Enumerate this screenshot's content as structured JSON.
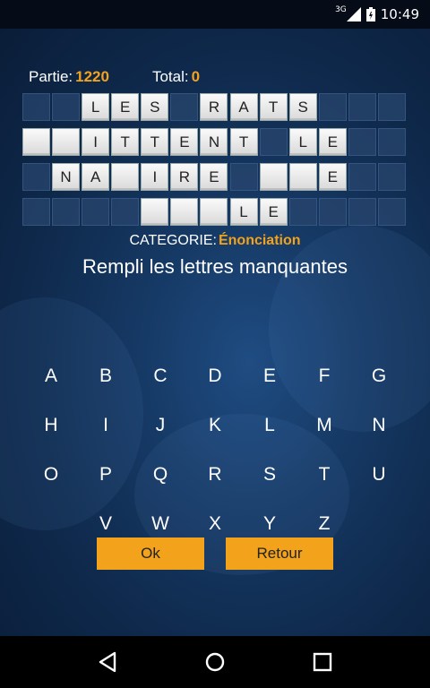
{
  "status_bar": {
    "network": "3G",
    "time": "10:49"
  },
  "scores": {
    "partie_label": "Partie:",
    "partie_value": "1220",
    "total_label": "Total:",
    "total_value": "0"
  },
  "board": {
    "rows": [
      [
        "",
        "",
        "L",
        "E",
        "S",
        "",
        "R",
        "A",
        "T",
        "S",
        "",
        "",
        ""
      ],
      [
        "+",
        "+",
        "I",
        "T",
        "T",
        "E",
        "N",
        "T",
        "",
        "L",
        "E",
        "",
        ""
      ],
      [
        "",
        "N",
        "A",
        "+",
        "I",
        "R",
        "E",
        "",
        "+",
        "+",
        "E",
        "",
        ""
      ],
      [
        "",
        "",
        "",
        "",
        "+",
        "+",
        "+",
        "L",
        "E",
        "",
        "",
        "",
        ""
      ]
    ],
    "tile_mask": [
      [
        0,
        0,
        1,
        1,
        1,
        0,
        1,
        1,
        1,
        1,
        0,
        0,
        0
      ],
      [
        1,
        1,
        1,
        1,
        1,
        1,
        1,
        1,
        0,
        1,
        1,
        0,
        0
      ],
      [
        0,
        1,
        1,
        1,
        1,
        1,
        1,
        0,
        1,
        1,
        1,
        0,
        0
      ],
      [
        0,
        0,
        0,
        0,
        1,
        1,
        1,
        1,
        1,
        0,
        0,
        0,
        0
      ]
    ]
  },
  "category": {
    "label": "CATEGORIE:",
    "value": "Énonciation"
  },
  "instruction": "Rempli les lettres manquantes",
  "keyboard": {
    "rows": [
      [
        "A",
        "B",
        "C",
        "D",
        "E",
        "F",
        "G"
      ],
      [
        "H",
        "I",
        "J",
        "K",
        "L",
        "M",
        "N"
      ],
      [
        "O",
        "P",
        "Q",
        "R",
        "S",
        "T",
        "U"
      ],
      [
        "V",
        "W",
        "X",
        "Y",
        "Z"
      ]
    ]
  },
  "buttons": {
    "ok_label": "Ok",
    "retour_label": "Retour"
  },
  "colors": {
    "accent": "#f2a21b",
    "background": "#163a66",
    "tile": "#ececec"
  },
  "nav_icons": [
    "back-icon",
    "home-icon",
    "recents-icon"
  ]
}
